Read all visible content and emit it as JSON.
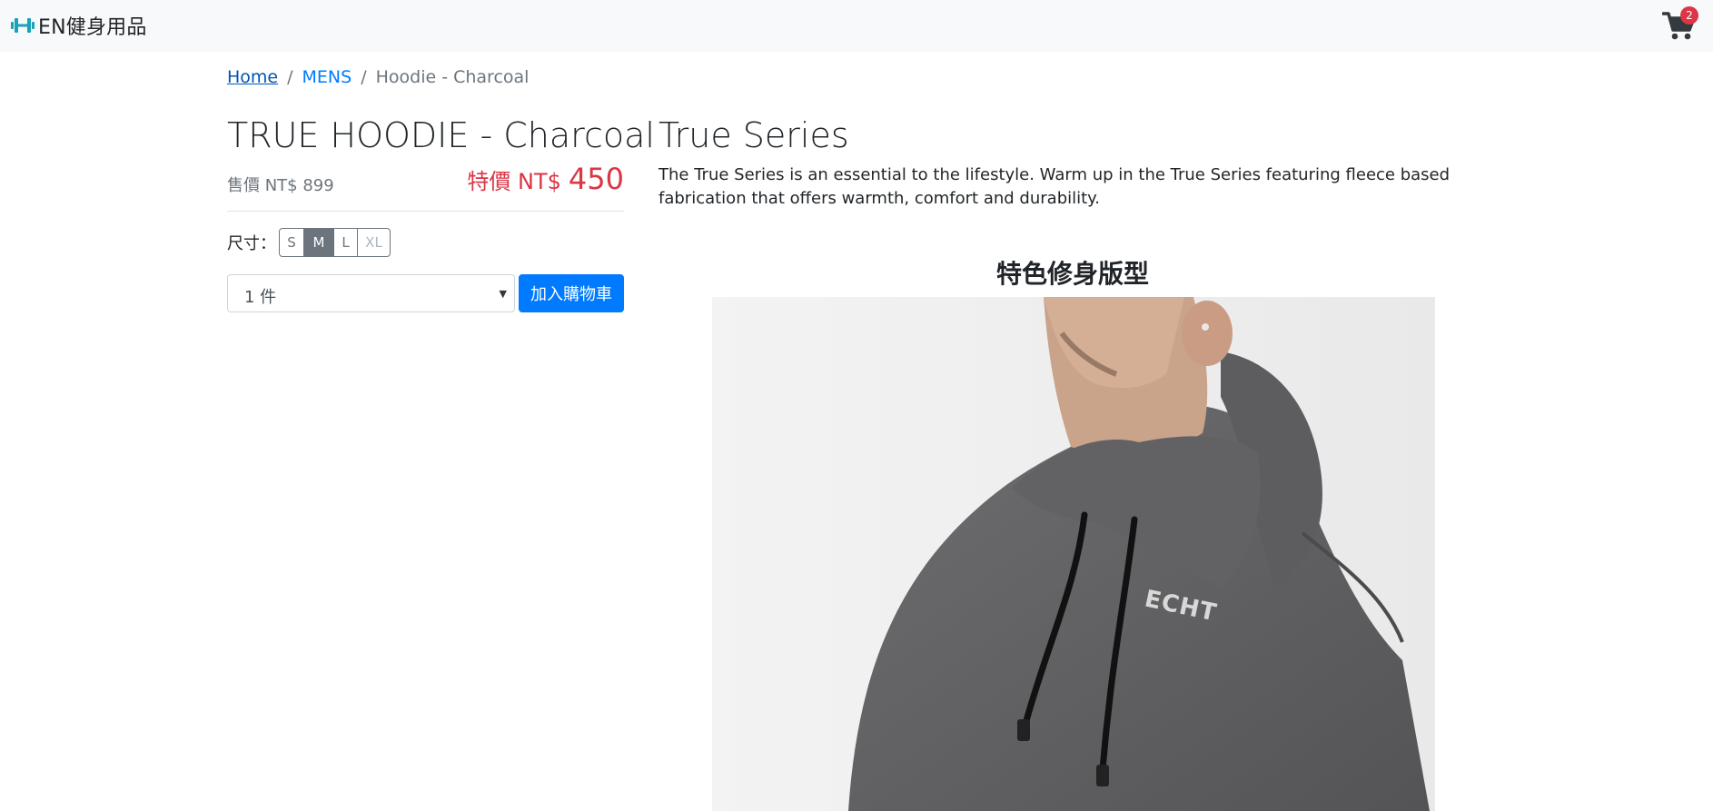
{
  "navbar": {
    "brand_text": "EN健身用品",
    "cart_count": "2"
  },
  "breadcrumb": {
    "home": "Home",
    "category": "MENS",
    "current": "Hoodie - Charcoal",
    "separator": "/"
  },
  "product": {
    "title": "TRUE HOODIE - Charcoal",
    "original_price": "售價 NT$ 899",
    "sale_label": "特價 NT$",
    "sale_value": "450",
    "size_label": "尺寸：",
    "sizes": [
      "S",
      "M",
      "L",
      "XL"
    ],
    "selected_size": "M",
    "quantity": "1 件",
    "add_to_cart": "加入購物車"
  },
  "description": {
    "series_title": "True Series",
    "text": "The True Series is an essential to the lifestyle. Warm up in the True Series featuring fleece based fabrication that offers warmth, comfort and durability.",
    "feature_heading": "特色修身版型",
    "garment_logo": "ECHT"
  },
  "colors": {
    "primary": "#007bff",
    "sale": "#dc3545",
    "muted": "#6c757d",
    "navbar_bg": "#f8f9fa",
    "brand_icon": "#17a2b8"
  },
  "icons": {
    "brand": "dumbbell-icon",
    "cart": "shopping-cart-icon",
    "select_caret": "caret-down-icon"
  }
}
